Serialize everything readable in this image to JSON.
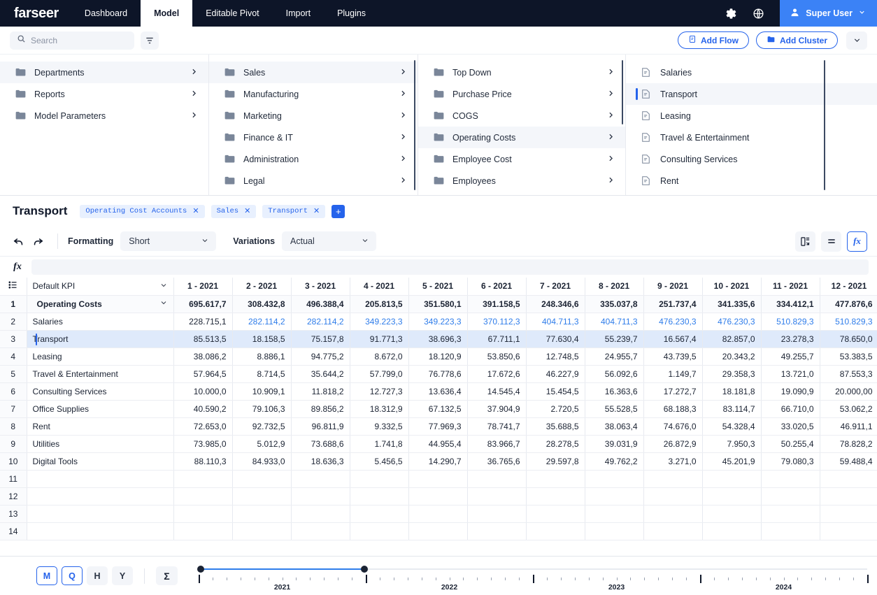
{
  "app": {
    "brand": "farseer",
    "nav_tabs": [
      {
        "label": "Dashboard",
        "active": false
      },
      {
        "label": "Model",
        "active": true
      },
      {
        "label": "Editable Pivot",
        "active": false
      },
      {
        "label": "Import",
        "active": false
      },
      {
        "label": "Plugins",
        "active": false
      }
    ],
    "icons": {
      "settings": "gear-icon",
      "globe": "globe-icon",
      "user": "user-icon"
    },
    "user": {
      "name": "Super User",
      "chevron": "chevron-down-icon"
    }
  },
  "search": {
    "placeholder": "Search",
    "search_icon": "search-icon",
    "filter_icon": "filter-icon",
    "add_flow": "Add Flow",
    "add_cluster": "Add Cluster",
    "add_flow_icon": "flow-icon",
    "add_cluster_icon": "folder-icon",
    "expand_icon": "chevron-down-icon"
  },
  "browser": {
    "columns": [
      {
        "icon_type": "folder",
        "items": [
          {
            "label": "Departments",
            "selected": true,
            "chevron": true
          },
          {
            "label": "Reports",
            "selected": false,
            "chevron": true
          },
          {
            "label": "Model Parameters",
            "selected": false,
            "chevron": true
          }
        ]
      },
      {
        "icon_type": "folder",
        "items": [
          {
            "label": "Sales",
            "selected": true,
            "chevron": true
          },
          {
            "label": "Manufacturing",
            "selected": false,
            "chevron": true
          },
          {
            "label": "Marketing",
            "selected": false,
            "chevron": true
          },
          {
            "label": "Finance & IT",
            "selected": false,
            "chevron": true
          },
          {
            "label": "Administration",
            "selected": false,
            "chevron": true
          },
          {
            "label": "Legal",
            "selected": false,
            "chevron": true
          }
        ]
      },
      {
        "icon_type": "folder",
        "items": [
          {
            "label": "Top Down",
            "selected": false,
            "chevron": true
          },
          {
            "label": "Purchase Price",
            "selected": false,
            "chevron": true
          },
          {
            "label": "COGS",
            "selected": false,
            "chevron": true
          },
          {
            "label": "Operating Costs",
            "selected": true,
            "chevron": true
          },
          {
            "label": "Employee Cost",
            "selected": false,
            "chevron": true
          },
          {
            "label": "Employees",
            "selected": false,
            "chevron": true
          }
        ]
      },
      {
        "icon_type": "document",
        "items": [
          {
            "label": "Salaries",
            "selected": false,
            "chevron": false
          },
          {
            "label": "Transport",
            "selected": true,
            "chevron": false,
            "marker": true
          },
          {
            "label": "Leasing",
            "selected": false,
            "chevron": false
          },
          {
            "label": "Travel & Entertainment",
            "selected": false,
            "chevron": false
          },
          {
            "label": "Consulting Services",
            "selected": false,
            "chevron": false
          },
          {
            "label": "Rent",
            "selected": false,
            "chevron": false
          }
        ]
      }
    ]
  },
  "document": {
    "title": "Transport",
    "tags": [
      {
        "label": "Operating Cost Accounts"
      },
      {
        "label": "Sales"
      },
      {
        "label": "Transport"
      }
    ],
    "add_tag": "+"
  },
  "toolbar": {
    "undo_icon": "undo-icon",
    "redo_icon": "redo-icon",
    "formatting_label": "Formatting",
    "formatting_value": "Short",
    "variations_label": "Variations",
    "variations_value": "Actual",
    "layout_icon": "layout-icon",
    "equals_icon": "equals-icon",
    "fx_icon": "fx-icon"
  },
  "formula_bar": {
    "fx_glyph": "fx",
    "value": ""
  },
  "grid": {
    "row_header_icon": "list-icon",
    "kpi_label": "Default KPI",
    "kpi_chevron": "chevron-down-icon",
    "columns": [
      "1 - 2021",
      "2 - 2021",
      "3 - 2021",
      "4 - 2021",
      "5 - 2021",
      "6 - 2021",
      "7 - 2021",
      "8 - 2021",
      "9 - 2021",
      "10 - 2021",
      "11 - 2021",
      "12 - 2021"
    ],
    "rows": [
      {
        "num": "1",
        "label": "Operating Costs",
        "level": 0,
        "bold": true,
        "expandable": true,
        "selected": false,
        "blue": false,
        "values": [
          "695.617,7",
          "308.432,8",
          "496.388,4",
          "205.813,5",
          "351.580,1",
          "391.158,5",
          "248.346,6",
          "335.037,8",
          "251.737,4",
          "341.335,6",
          "334.412,1",
          "477.876,6"
        ]
      },
      {
        "num": "2",
        "label": "Salaries",
        "level": 1,
        "bold": false,
        "expandable": false,
        "selected": false,
        "blue": true,
        "values": [
          "228.715,1",
          "282.114,2",
          "282.114,2",
          "349.223,3",
          "349.223,3",
          "370.112,3",
          "404.711,3",
          "404.711,3",
          "476.230,3",
          "476.230,3",
          "510.829,3",
          "510.829,3"
        ],
        "blue_from": 1
      },
      {
        "num": "3",
        "label": "Transport",
        "level": 1,
        "bold": false,
        "expandable": false,
        "selected": true,
        "blue": false,
        "values": [
          "85.513,5",
          "18.158,5",
          "75.157,8",
          "91.771,3",
          "38.696,3",
          "67.711,1",
          "77.630,4",
          "55.239,7",
          "16.567,4",
          "82.857,0",
          "23.278,3",
          "78.650,0"
        ]
      },
      {
        "num": "4",
        "label": "Leasing",
        "level": 1,
        "bold": false,
        "expandable": false,
        "selected": false,
        "blue": false,
        "values": [
          "38.086,2",
          "8.886,1",
          "94.775,2",
          "8.672,0",
          "18.120,9",
          "53.850,6",
          "12.748,5",
          "24.955,7",
          "43.739,5",
          "20.343,2",
          "49.255,7",
          "53.383,5"
        ]
      },
      {
        "num": "5",
        "label": "Travel & Entertainment",
        "level": 1,
        "bold": false,
        "expandable": false,
        "selected": false,
        "blue": false,
        "values": [
          "57.964,5",
          "8.714,5",
          "35.644,2",
          "57.799,0",
          "76.778,6",
          "17.672,6",
          "46.227,9",
          "56.092,6",
          "1.149,7",
          "29.358,3",
          "13.721,0",
          "87.553,3"
        ]
      },
      {
        "num": "6",
        "label": "Consulting Services",
        "level": 1,
        "bold": false,
        "expandable": false,
        "selected": false,
        "blue": false,
        "values": [
          "10.000,0",
          "10.909,1",
          "11.818,2",
          "12.727,3",
          "13.636,4",
          "14.545,4",
          "15.454,5",
          "16.363,6",
          "17.272,7",
          "18.181,8",
          "19.090,9",
          "20.000,00"
        ]
      },
      {
        "num": "7",
        "label": "Office Supplies",
        "level": 1,
        "bold": false,
        "expandable": false,
        "selected": false,
        "blue": false,
        "values": [
          "40.590,2",
          "79.106,3",
          "89.856,2",
          "18.312,9",
          "67.132,5",
          "37.904,9",
          "2.720,5",
          "55.528,5",
          "68.188,3",
          "83.114,7",
          "66.710,0",
          "53.062,2"
        ]
      },
      {
        "num": "8",
        "label": "Rent",
        "level": 1,
        "bold": false,
        "expandable": false,
        "selected": false,
        "blue": false,
        "values": [
          "72.653,0",
          "92.732,5",
          "96.811,9",
          "9.332,5",
          "77.969,3",
          "78.741,7",
          "35.688,5",
          "38.063,4",
          "74.676,0",
          "54.328,4",
          "33.020,5",
          "46.911,1"
        ]
      },
      {
        "num": "9",
        "label": "Utilities",
        "level": 1,
        "bold": false,
        "expandable": false,
        "selected": false,
        "blue": false,
        "values": [
          "73.985,0",
          "5.012,9",
          "73.688,6",
          "1.741,8",
          "44.955,4",
          "83.966,7",
          "28.278,5",
          "39.031,9",
          "26.872,9",
          "7.950,3",
          "50.255,4",
          "78.828,2"
        ]
      },
      {
        "num": "10",
        "label": "Digital Tools",
        "level": 1,
        "bold": false,
        "expandable": false,
        "selected": false,
        "blue": false,
        "values": [
          "88.110,3",
          "84.933,0",
          "18.636,3",
          "5.456,5",
          "14.290,7",
          "36.765,6",
          "29.597,8",
          "49.762,2",
          "3.271,0",
          "45.201,9",
          "79.080,3",
          "59.488,4"
        ]
      },
      {
        "num": "11",
        "label": "",
        "level": 1,
        "blank": true,
        "values": [
          "",
          "",
          "",
          "",
          "",
          "",
          "",
          "",
          "",
          "",
          "",
          ""
        ]
      },
      {
        "num": "12",
        "label": "",
        "level": 1,
        "blank": true,
        "values": [
          "",
          "",
          "",
          "",
          "",
          "",
          "",
          "",
          "",
          "",
          "",
          ""
        ]
      },
      {
        "num": "13",
        "label": "",
        "level": 1,
        "blank": true,
        "values": [
          "",
          "",
          "",
          "",
          "",
          "",
          "",
          "",
          "",
          "",
          "",
          ""
        ]
      },
      {
        "num": "14",
        "label": "",
        "level": 1,
        "blank": true,
        "values": [
          "",
          "",
          "",
          "",
          "",
          "",
          "",
          "",
          "",
          "",
          "",
          ""
        ]
      }
    ]
  },
  "footer": {
    "granularity": [
      {
        "label": "M",
        "active": true
      },
      {
        "label": "Q",
        "active": true
      },
      {
        "label": "H",
        "active": false
      },
      {
        "label": "Y",
        "active": false
      }
    ],
    "sigma": "Σ",
    "timeline": {
      "years": [
        "2021",
        "2022",
        "2023",
        "2024"
      ],
      "range_start_year": "2021",
      "range_end_year": "2021",
      "months_per_year": 12
    }
  },
  "colors": {
    "nav_bg": "#0d1528",
    "accent": "#2563eb",
    "user_chip": "#3b82f6",
    "formula_blue": "#2f7dea",
    "selected_row": "#dfeafb",
    "tag_bg": "#e8f0fe"
  }
}
